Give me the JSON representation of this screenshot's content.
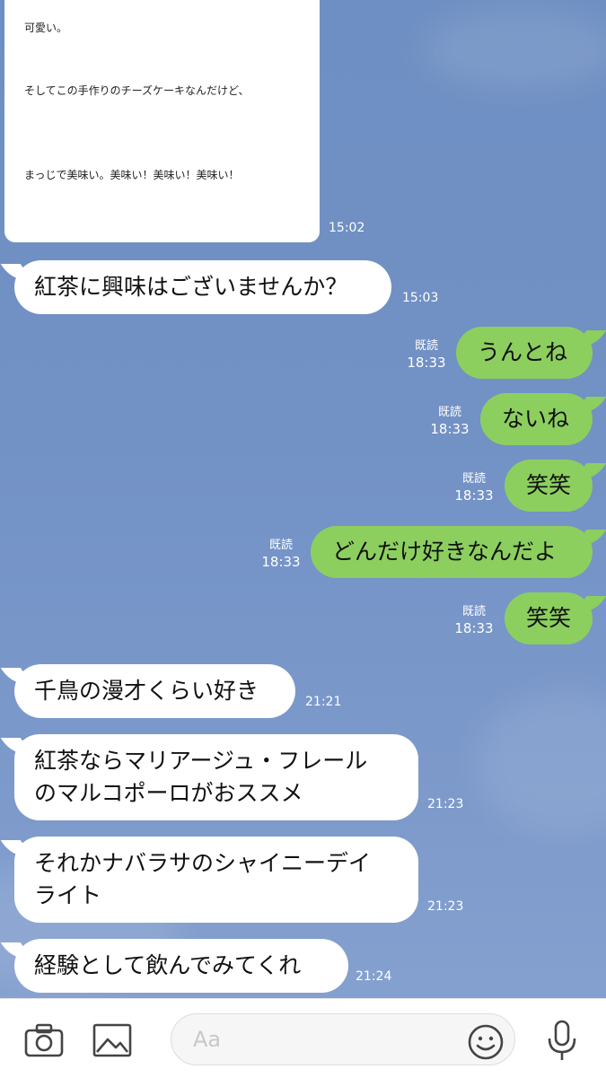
{
  "card": {
    "lines": [
      "可愛い。",
      "そしてこの手作りのチーズケーキなんだけど、",
      "まっじで美味い。美味い！美味い！美味い！"
    ],
    "time": "15:02"
  },
  "messages": [
    {
      "side": "in",
      "text": "紅茶に興味はございませんか？",
      "time": "15:03"
    },
    {
      "side": "out",
      "text": "うんとね",
      "read": "既読",
      "time": "18:33"
    },
    {
      "side": "out",
      "text": "ないね",
      "read": "既読",
      "time": "18:33"
    },
    {
      "side": "out",
      "text": "笑笑",
      "read": "既読",
      "time": "18:33"
    },
    {
      "side": "out",
      "text": "どんだけ好きなんだよ",
      "read": "既読",
      "time": "18:33"
    },
    {
      "side": "out",
      "text": "笑笑",
      "read": "既読",
      "time": "18:33"
    },
    {
      "side": "in",
      "text": "千鳥の漫才くらい好き",
      "time": "21:21"
    },
    {
      "side": "in",
      "lines": [
        "紅茶ならマリアージュ・フレール",
        "のマルコポーロがおススメ"
      ],
      "time": "21:23"
    },
    {
      "side": "in",
      "lines": [
        "それかナバラサのシャイニーデイ",
        "ライト"
      ],
      "time": "21:23"
    },
    {
      "side": "in",
      "text": "経験として飲んでみてくれ",
      "time": "21:24"
    }
  ],
  "input_bar": {
    "placeholder": "Aa",
    "icons": [
      "camera-icon",
      "image-icon",
      "emoji-icon",
      "microphone-icon"
    ]
  },
  "colors": {
    "background": "#7291c5",
    "outgoing_bubble": "#8ccf5f",
    "incoming_bubble": "#ffffff"
  }
}
